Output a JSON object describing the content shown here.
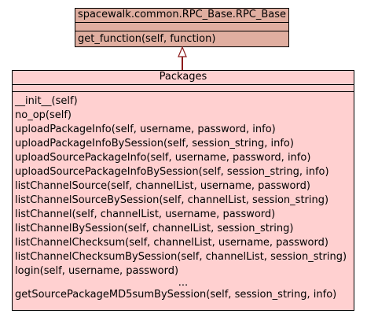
{
  "base_class": {
    "name": "spacewalk.common.RPC_Base.RPC_Base",
    "attributes": [],
    "operations": [
      "get_function(self, function)"
    ]
  },
  "derived_class": {
    "name": "Packages",
    "attributes": [],
    "operations": [
      "__init__(self)",
      "no_op(self)",
      "uploadPackageInfo(self, username, password, info)",
      "uploadPackageInfoBySession(self, session_string, info)",
      "uploadSourcePackageInfo(self, username, password, info)",
      "uploadSourcePackageInfoBySession(self, session_string, info)",
      "listChannelSource(self, channelList, username, password)",
      "listChannelSourceBySession(self, channelList, session_string)",
      "listChannel(self, channelList, username, password)",
      "listChannelBySession(self, channelList, session_string)",
      "listChannelChecksum(self, channelList, username, password)",
      "listChannelChecksumBySession(self, channelList, session_string)",
      "login(self, username, password)",
      "...",
      "getSourcePackageMD5sumBySession(self, session_string, info)"
    ]
  },
  "colors": {
    "base_fill": "#e0aea0",
    "derived_fill": "#ffd0d0",
    "arrow": "#8b1a1a"
  },
  "relationship": "inheritance"
}
